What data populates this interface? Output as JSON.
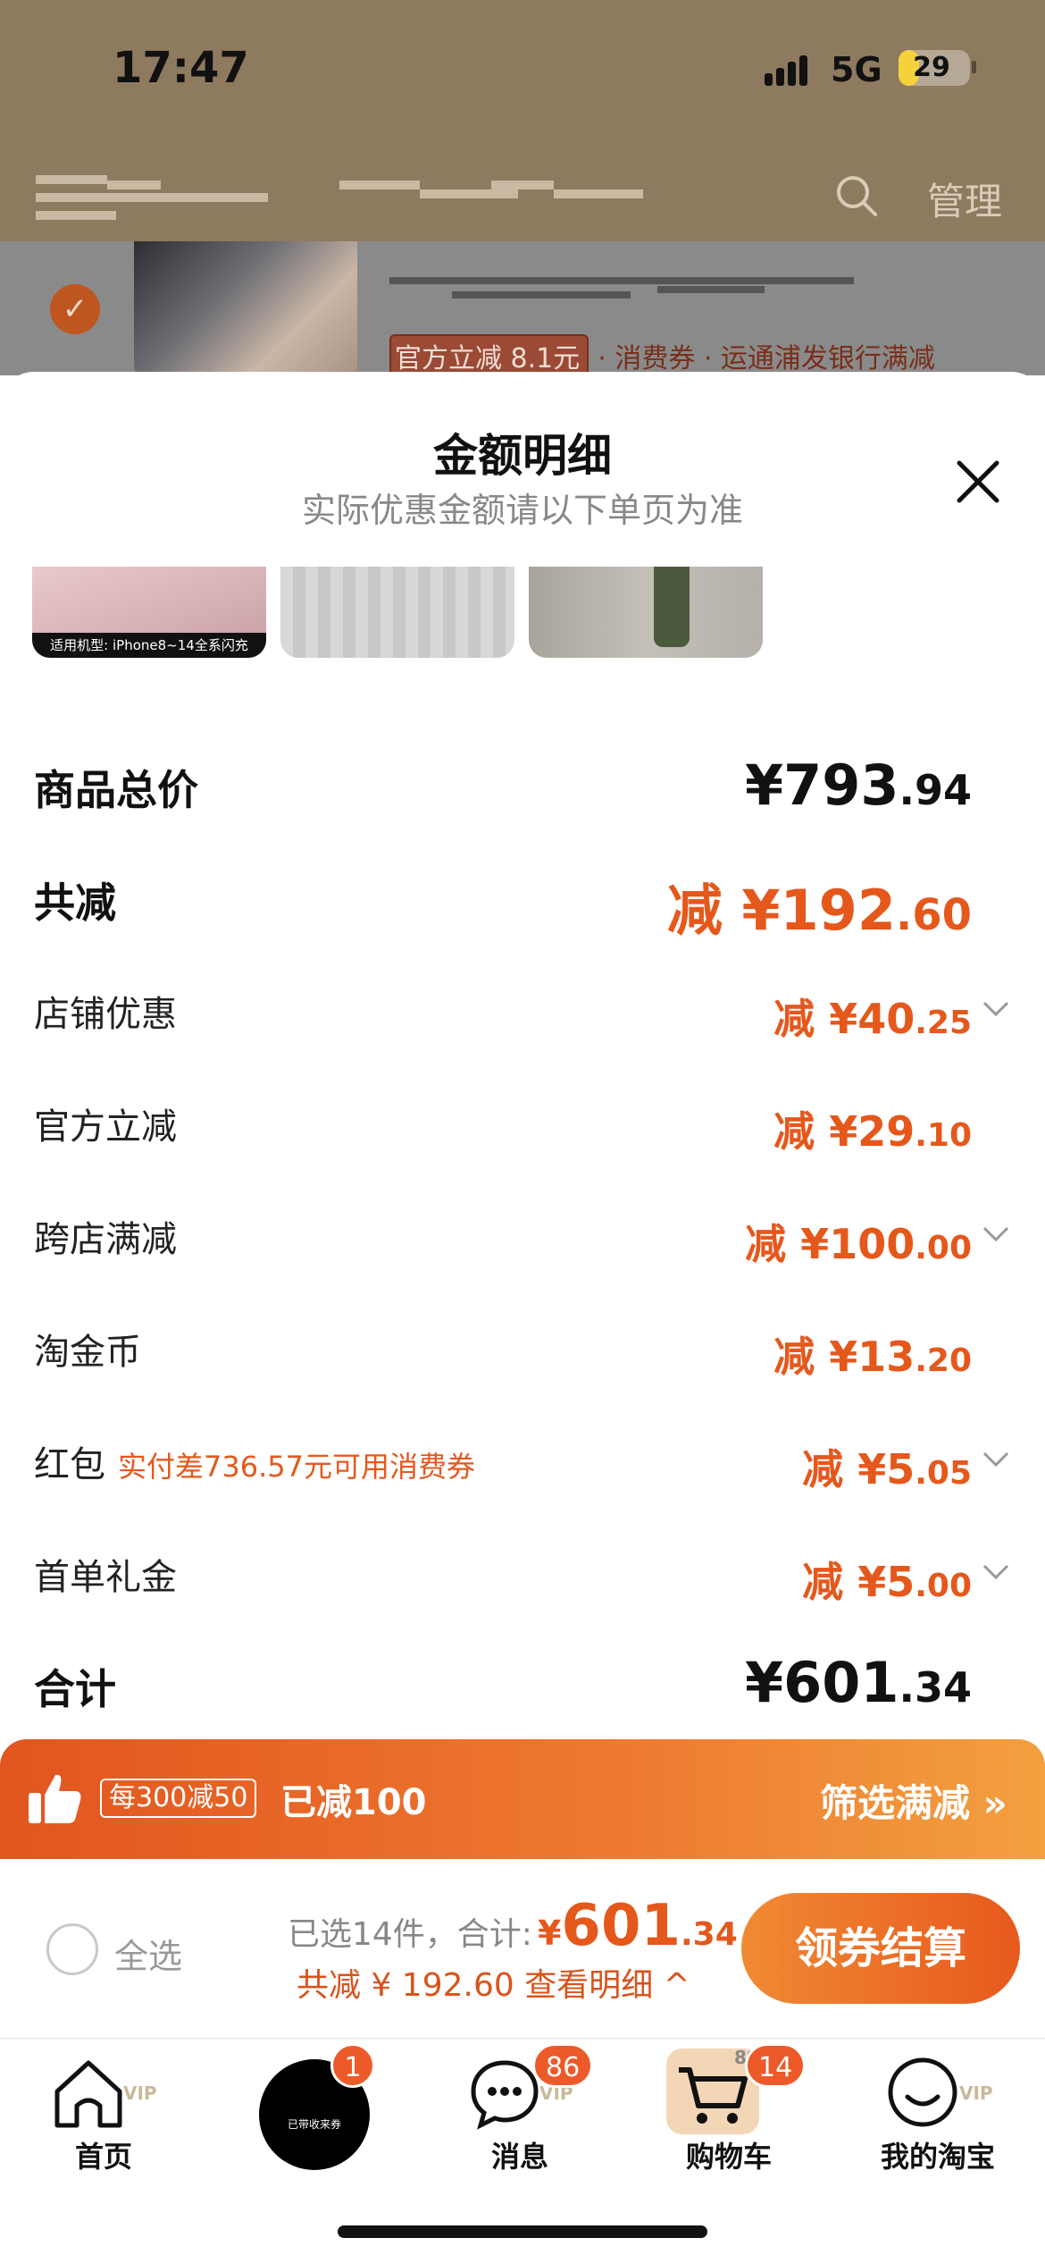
{
  "status_bar": {
    "time": "17:47",
    "network": "5G",
    "battery": "29",
    "battery_level_percent": 29
  },
  "background": {
    "manage_label": "管理",
    "cart_item": {
      "promo_badge": "官方立减 8.1元",
      "promo_text": "· 消费券 · 运通浦发银行满减"
    }
  },
  "sheet": {
    "title": "金额明细",
    "subtitle": "实际优惠金额请以下单页为准",
    "thumb_caption": "适用机型: iPhone8~14全系闪充",
    "rows": [
      {
        "label": "商品总价",
        "currency": "¥",
        "whole": "793",
        "cents": ".94"
      },
      {
        "label": "共减",
        "prefix": "减 ",
        "currency": "¥",
        "whole": "192",
        "cents": ".60"
      },
      {
        "label": "店铺优惠",
        "prefix": "减 ",
        "currency": "¥",
        "whole": "40",
        "cents": ".25"
      },
      {
        "label": "官方立减",
        "prefix": "减 ",
        "currency": "¥",
        "whole": "29",
        "cents": ".10"
      },
      {
        "label": "跨店满减",
        "prefix": "减 ",
        "currency": "¥",
        "whole": "100",
        "cents": ".00"
      },
      {
        "label": "淘金币",
        "prefix": "减 ",
        "currency": "¥",
        "whole": "13",
        "cents": ".20"
      },
      {
        "label": "红包",
        "note": "实付差736.57元可用消费券",
        "prefix": "减 ",
        "currency": "¥",
        "whole": "5",
        "cents": ".05"
      },
      {
        "label": "首单礼金",
        "prefix": "减 ",
        "currency": "¥",
        "whole": "5",
        "cents": ".00"
      },
      {
        "label": "合计",
        "currency": "¥",
        "whole": "601",
        "cents": ".34"
      }
    ]
  },
  "promo_bar": {
    "rule": "每300减50",
    "saved": "已减100",
    "filter": "筛选满减 »"
  },
  "checkout": {
    "select_all": "全选",
    "selected_text": "已选14件，合计:",
    "currency": "¥",
    "total_whole": "601",
    "total_cents": ".34",
    "discount_text": "共减 ¥ 192.60  查看明细 ^",
    "button": "领券结算"
  },
  "tab_bar": {
    "items": [
      {
        "label": "首页",
        "icon": "home-icon",
        "vip": "VIP"
      },
      {
        "label": "",
        "icon": "center-promo-icon",
        "badge": "1",
        "center_text": "已带收来券"
      },
      {
        "label": "消息",
        "icon": "message-icon",
        "badge": "86",
        "vip": "VIP"
      },
      {
        "label": "购物车",
        "icon": "cart-icon",
        "badge": "14",
        "small": "89"
      },
      {
        "label": "我的淘宝",
        "icon": "profile-icon",
        "vip": "VIP"
      }
    ]
  },
  "colors": {
    "accent": "#e5581c",
    "promo_gradient_start": "#e2551f",
    "promo_gradient_end": "#f2a040",
    "dim_background": "#8e7a5f"
  }
}
